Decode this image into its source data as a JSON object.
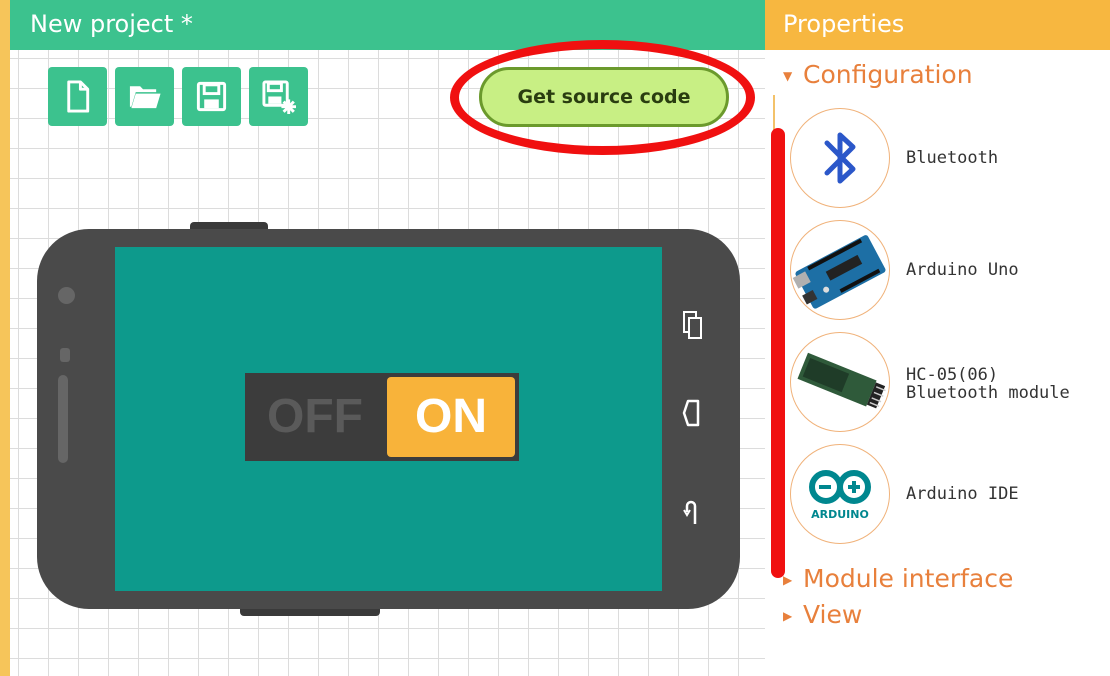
{
  "project": {
    "title": "New project *"
  },
  "toolbar": {
    "icons": [
      "new-file-icon",
      "open-folder-icon",
      "save-icon",
      "save-as-icon"
    ],
    "get_source_label": "Get source code"
  },
  "phone": {
    "toggle": {
      "off_label": "OFF",
      "on_label": "ON",
      "state": "on"
    }
  },
  "properties": {
    "title": "Properties",
    "sections": [
      {
        "label": "Configuration",
        "expanded": true
      },
      {
        "label": "Module interface",
        "expanded": false
      },
      {
        "label": "View",
        "expanded": false
      }
    ],
    "configuration_items": [
      {
        "label_line1": "Bluetooth",
        "label_line2": ""
      },
      {
        "label_line1": "Arduino Uno",
        "label_line2": ""
      },
      {
        "label_line1": "HC-05(06)",
        "label_line2": "Bluetooth module"
      },
      {
        "label_line1": "Arduino IDE",
        "label_line2": "",
        "logo_text": "ARDUINO"
      }
    ]
  },
  "colors": {
    "left_header": "#3cc28e",
    "right_header": "#f7b740",
    "section_text": "#e8803c",
    "phone_screen": "#0d9a8c",
    "toggle_on": "#f8b33a",
    "annotation_red": "#f01010"
  }
}
